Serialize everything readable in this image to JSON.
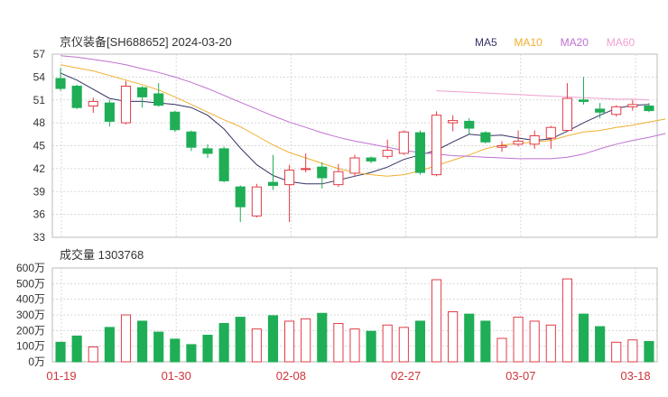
{
  "header": {
    "title": "京仪装备[SH688652] 2024-03-20"
  },
  "volume_title": "成交量 1303768",
  "legend": [
    {
      "name": "MA5",
      "color": "#333366"
    },
    {
      "name": "MA10",
      "color": "#f0b030"
    },
    {
      "name": "MA20",
      "color": "#c070d0"
    },
    {
      "name": "MA60",
      "color": "#f0a0d0"
    }
  ],
  "colors": {
    "up": "#e03c46",
    "down": "#1fae56",
    "grid": "#d8d8d8"
  },
  "chart_data": [
    {
      "type": "candlestick",
      "y_ticks": [
        "57",
        "54",
        "51",
        "48",
        "45",
        "42",
        "39",
        "36",
        "33"
      ],
      "ylim": [
        33,
        57
      ],
      "x_ticks": [
        "01-19",
        "01-30",
        "02-08",
        "02-27",
        "03-07",
        "03-18"
      ],
      "candles": [
        {
          "o": 53.8,
          "c": 52.5,
          "h": 55.2,
          "l": 52.2
        },
        {
          "o": 52.8,
          "c": 50.0,
          "h": 53.0,
          "l": 49.8
        },
        {
          "o": 50.2,
          "c": 50.8,
          "h": 51.3,
          "l": 49.3
        },
        {
          "o": 50.6,
          "c": 48.2,
          "h": 51.0,
          "l": 47.5
        },
        {
          "o": 48.0,
          "c": 52.8,
          "h": 53.5,
          "l": 47.8
        },
        {
          "o": 52.6,
          "c": 51.4,
          "h": 52.8,
          "l": 50.0
        },
        {
          "o": 51.8,
          "c": 50.3,
          "h": 53.2,
          "l": 50.1
        },
        {
          "o": 49.4,
          "c": 47.1,
          "h": 49.6,
          "l": 46.8
        },
        {
          "o": 46.8,
          "c": 44.8,
          "h": 47.0,
          "l": 44.3
        },
        {
          "o": 44.6,
          "c": 44.0,
          "h": 45.2,
          "l": 43.4
        },
        {
          "o": 44.6,
          "c": 40.4,
          "h": 44.9,
          "l": 40.2
        },
        {
          "o": 39.6,
          "c": 37.0,
          "h": 39.8,
          "l": 35.0
        },
        {
          "o": 35.8,
          "c": 39.6,
          "h": 40.0,
          "l": 35.6
        },
        {
          "o": 40.2,
          "c": 39.8,
          "h": 43.8,
          "l": 39.2
        },
        {
          "o": 39.9,
          "c": 41.8,
          "h": 42.5,
          "l": 35.0
        },
        {
          "o": 41.9,
          "c": 42.0,
          "h": 44.0,
          "l": 41.5
        },
        {
          "o": 42.2,
          "c": 40.8,
          "h": 42.8,
          "l": 39.4
        },
        {
          "o": 39.9,
          "c": 41.6,
          "h": 42.6,
          "l": 39.6
        },
        {
          "o": 41.4,
          "c": 43.4,
          "h": 43.8,
          "l": 41.0
        },
        {
          "o": 43.4,
          "c": 43.0,
          "h": 43.6,
          "l": 42.7
        },
        {
          "o": 43.6,
          "c": 44.4,
          "h": 45.8,
          "l": 43.3
        },
        {
          "o": 44.0,
          "c": 46.8,
          "h": 47.0,
          "l": 43.8
        },
        {
          "o": 46.7,
          "c": 41.5,
          "h": 47.0,
          "l": 41.2
        },
        {
          "o": 41.2,
          "c": 49.0,
          "h": 49.5,
          "l": 41.0
        },
        {
          "o": 48.0,
          "c": 48.3,
          "h": 49.0,
          "l": 46.9
        },
        {
          "o": 48.2,
          "c": 47.3,
          "h": 48.6,
          "l": 46.5
        },
        {
          "o": 46.7,
          "c": 45.5,
          "h": 46.9,
          "l": 45.3
        },
        {
          "o": 44.8,
          "c": 45.0,
          "h": 45.6,
          "l": 44.2
        },
        {
          "o": 45.2,
          "c": 45.6,
          "h": 47.0,
          "l": 44.9
        },
        {
          "o": 45.2,
          "c": 46.3,
          "h": 47.0,
          "l": 44.6
        },
        {
          "o": 46.0,
          "c": 47.4,
          "h": 47.6,
          "l": 44.6
        },
        {
          "o": 47.0,
          "c": 51.2,
          "h": 53.2,
          "l": 46.9
        },
        {
          "o": 51.0,
          "c": 50.8,
          "h": 54.0,
          "l": 50.4
        },
        {
          "o": 49.8,
          "c": 49.4,
          "h": 50.6,
          "l": 48.6
        },
        {
          "o": 49.1,
          "c": 50.1,
          "h": 50.3,
          "l": 48.8
        },
        {
          "o": 50.1,
          "c": 50.4,
          "h": 51.0,
          "l": 49.6
        },
        {
          "o": 50.2,
          "c": 49.6,
          "h": 50.6,
          "l": 49.4
        }
      ],
      "series": [
        {
          "name": "MA5",
          "color": "#333366",
          "start": 0,
          "values": [
            54.5,
            53.6,
            52.4,
            51.2,
            50.8,
            50.8,
            50.6,
            50.4,
            50.0,
            49.0,
            47.2,
            44.7,
            42.5,
            41.1,
            40.3,
            40.0,
            40.0,
            40.5,
            41.0,
            41.5,
            42.2,
            43.2,
            43.8,
            44.4,
            45.5,
            46.5,
            46.3,
            46.4,
            46.0,
            45.7,
            45.9,
            46.9,
            48.0,
            49.0,
            49.9,
            50.3,
            50.4
          ]
        },
        {
          "name": "MA10",
          "color": "#f0b030",
          "start": 0,
          "values": [
            55.6,
            55.2,
            54.8,
            54.2,
            53.6,
            53.0,
            52.3,
            51.4,
            50.4,
            49.4,
            48.4,
            47.5,
            46.3,
            45.1,
            44.1,
            43.4,
            42.7,
            42.0,
            41.5,
            41.2,
            41.0,
            41.2,
            41.7,
            42.4,
            43.1,
            43.8,
            44.6,
            45.1,
            45.3,
            45.5,
            45.7,
            46.3,
            46.8,
            47.0,
            47.4,
            47.7,
            48.1,
            48.5
          ]
        },
        {
          "name": "MA20",
          "color": "#c070d0",
          "start": 0,
          "values": [
            56.8,
            56.6,
            56.3,
            56.0,
            55.6,
            55.1,
            54.6,
            54.0,
            53.3,
            52.5,
            51.6,
            50.7,
            49.8,
            48.9,
            48.1,
            47.4,
            46.7,
            46.1,
            45.6,
            45.2,
            44.8,
            44.4,
            44.1,
            43.9,
            43.7,
            43.6,
            43.5,
            43.4,
            43.3,
            43.3,
            43.3,
            43.5,
            43.9,
            44.6,
            45.2,
            45.7,
            46.1,
            46.6
          ]
        },
        {
          "name": "MA60",
          "color": "#f0a0d0",
          "start": 23,
          "values": [
            52.2,
            52.1,
            52.0,
            51.9,
            51.8,
            51.7,
            51.6,
            51.5,
            51.4,
            51.3,
            51.2,
            51.1,
            51.1,
            51.0
          ]
        }
      ]
    },
    {
      "type": "bar",
      "y_ticks": [
        "600万",
        "500万",
        "400万",
        "300万",
        "200万",
        "100万",
        "0万"
      ],
      "ylim": [
        0,
        600
      ],
      "unit": "万",
      "values": [
        125,
        165,
        95,
        220,
        300,
        260,
        190,
        145,
        110,
        170,
        245,
        285,
        210,
        295,
        260,
        275,
        310,
        245,
        210,
        195,
        235,
        220,
        260,
        525,
        320,
        305,
        260,
        150,
        285,
        260,
        235,
        530,
        305,
        225,
        125,
        140,
        130
      ]
    }
  ]
}
